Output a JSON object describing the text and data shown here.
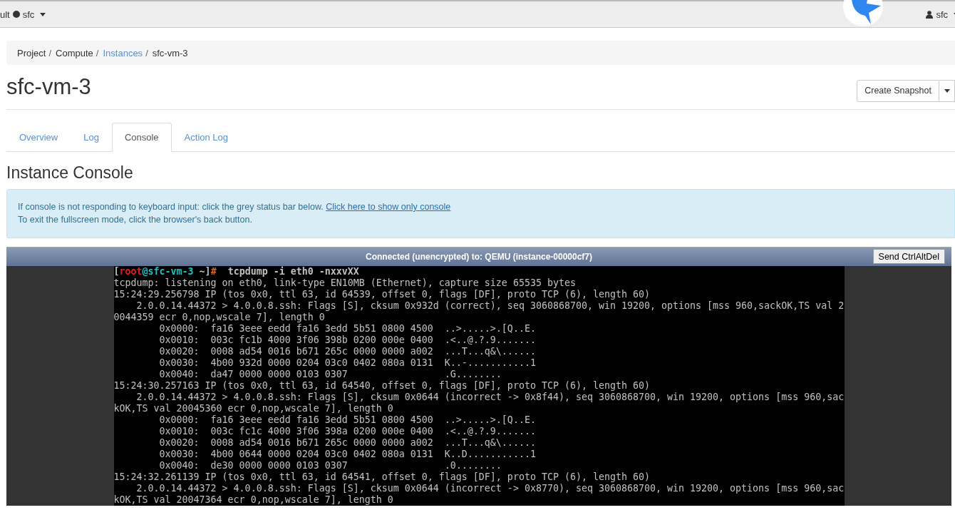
{
  "navbar": {
    "domain": "ult",
    "project": "sfc",
    "user": "sfc"
  },
  "breadcrumb": [
    {
      "label": "Project",
      "link": false,
      "separator": "/"
    },
    {
      "label": "Compute",
      "link": false,
      "separator": "/"
    },
    {
      "label": "Instances",
      "link": true,
      "separator": "/"
    },
    {
      "label": "sfc-vm-3",
      "link": false
    }
  ],
  "page_title": "sfc-vm-3",
  "actions": {
    "primary": "Create Snapshot"
  },
  "tabs": [
    {
      "label": "Overview",
      "selected": false
    },
    {
      "label": "Log",
      "selected": false
    },
    {
      "label": "Console",
      "selected": true
    },
    {
      "label": "Action Log",
      "selected": false
    }
  ],
  "section_title": "Instance Console",
  "info": {
    "text": "If console is not responding to keyboard input: click the grey status bar below. ",
    "link": "Click here to show only console",
    "note": "To exit the fullscreen mode, click the browser's back button."
  },
  "console": {
    "status": "Connected (unencrypted) to: QEMU (instance-00000cf7)",
    "button": "Send CtrlAltDel",
    "prompt": [
      {
        "text": "["
      },
      {
        "text": "root",
        "color": "#e02020"
      },
      {
        "text": "@sfc-vm-3",
        "color": "#20c0c0"
      },
      {
        "text": " ~]"
      },
      {
        "text": "#",
        "color": "#e06020"
      },
      {
        "text": "  tcpdump -i eth0 -nxxvXX"
      }
    ],
    "lines": [
      "tcpdump: listening on eth0, link-type EN10MB (Ethernet), capture size 65535 bytes",
      "15:24:29.256798 IP (tos 0x0, ttl 63, id 64539, offset 0, flags [DF], proto TCP (6), length 60)",
      "    2.0.0.14.44372 > 4.0.0.8.ssh: Flags [S], cksum 0x932d (correct), seq 3060868700, win 19200, options [mss 960,sackOK,TS val 2",
      "0044359 ecr 0,nop,wscale 7], length 0",
      "        0x0000:  fa16 3eee eedd fa16 3edd 5b51 0800 4500  ..>.....>.[Q..E.",
      "        0x0010:  003c fc1b 4000 3f06 398b 0200 000e 0400  .<..@.?.9.......",
      "        0x0020:  0008 ad54 0016 b671 265c 0000 0000 a002  ...T...q&\\......",
      "        0x0030:  4b00 932d 0000 0204 03c0 0402 080a 0131  K..-...........1",
      "        0x0040:  da47 0000 0000 0103 0307                 .G........",
      "15:24:30.257163 IP (tos 0x0, ttl 63, id 64540, offset 0, flags [DF], proto TCP (6), length 60)",
      "    2.0.0.14.44372 > 4.0.0.8.ssh: Flags [S], cksum 0x0644 (incorrect -> 0x8f44), seq 3060868700, win 19200, options [mss 960,sac",
      "kOK,TS val 20045360 ecr 0,nop,wscale 7], length 0",
      "        0x0000:  fa16 3eee eedd fa16 3edd 5b51 0800 4500  ..>.....>.[Q..E.",
      "        0x0010:  003c fc1c 4000 3f06 398a 0200 000e 0400  .<..@.?.9.......",
      "        0x0020:  0008 ad54 0016 b671 265c 0000 0000 a002  ...T...q&\\......",
      "        0x0030:  4b00 0644 0000 0204 03c0 0402 080a 0131  K..D...........1",
      "        0x0040:  de30 0000 0000 0103 0307                 .0........",
      "15:24:32.261139 IP (tos 0x0, ttl 63, id 64541, offset 0, flags [DF], proto TCP (6), length 60)",
      "    2.0.0.14.44372 > 4.0.0.8.ssh: Flags [S], cksum 0x0644 (incorrect -> 0x8770), seq 3060868700, win 19200, options [mss 960,sac",
      "kOK,TS val 20047364 ecr 0,nop,wscale 7], length 0"
    ]
  }
}
